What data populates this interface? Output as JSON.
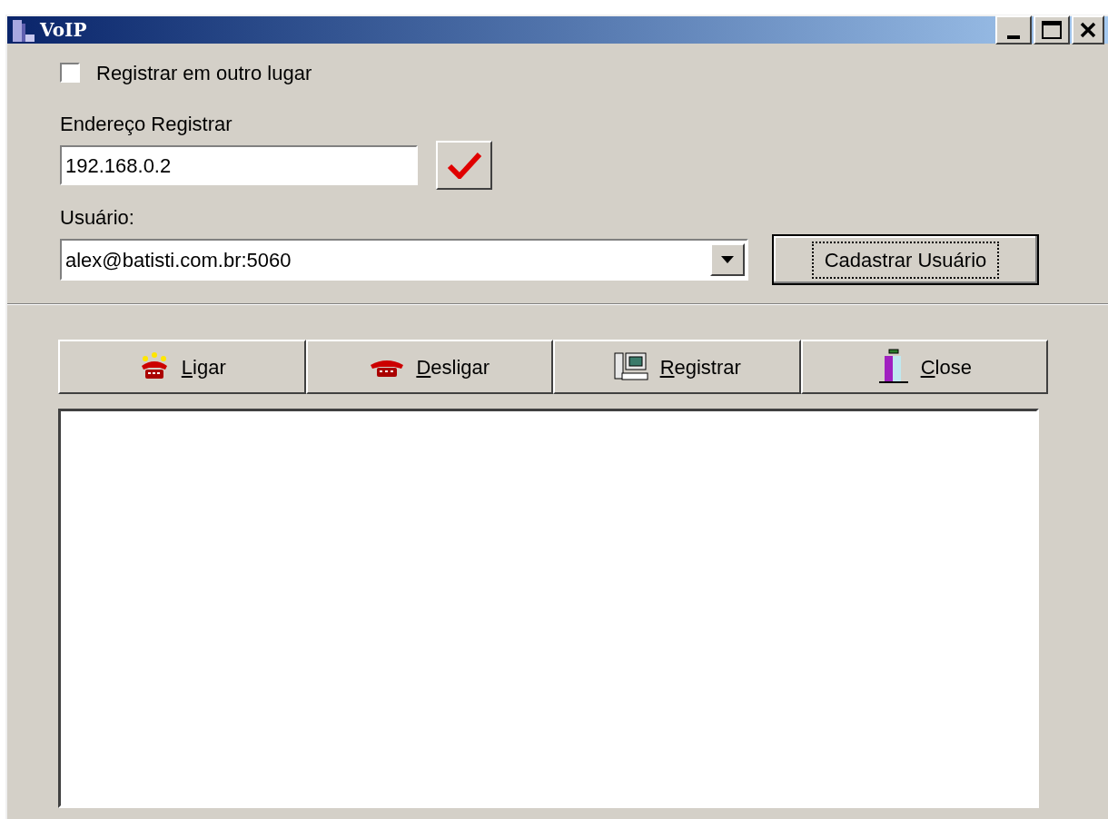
{
  "window": {
    "title": "VoIP"
  },
  "register_elsewhere": {
    "label": "Registrar em outro lugar",
    "checked": false
  },
  "address": {
    "label": "Endereço Registrar",
    "value": "192.168.0.2"
  },
  "user": {
    "label": "Usuário:",
    "value": "alex@batisti.com.br:5060"
  },
  "register_user_button": {
    "label": "Cadastrar Usuário",
    "focused": true
  },
  "toolbar": [
    {
      "kind": "call",
      "label": "Ligar",
      "mnemonic_underlined": true
    },
    {
      "kind": "hangup",
      "label": "Desligar",
      "mnemonic_underlined": true
    },
    {
      "kind": "register",
      "label": "Registrar",
      "mnemonic_underlined": true
    },
    {
      "kind": "close",
      "label": "Close",
      "mnemonic_underlined": true
    }
  ]
}
